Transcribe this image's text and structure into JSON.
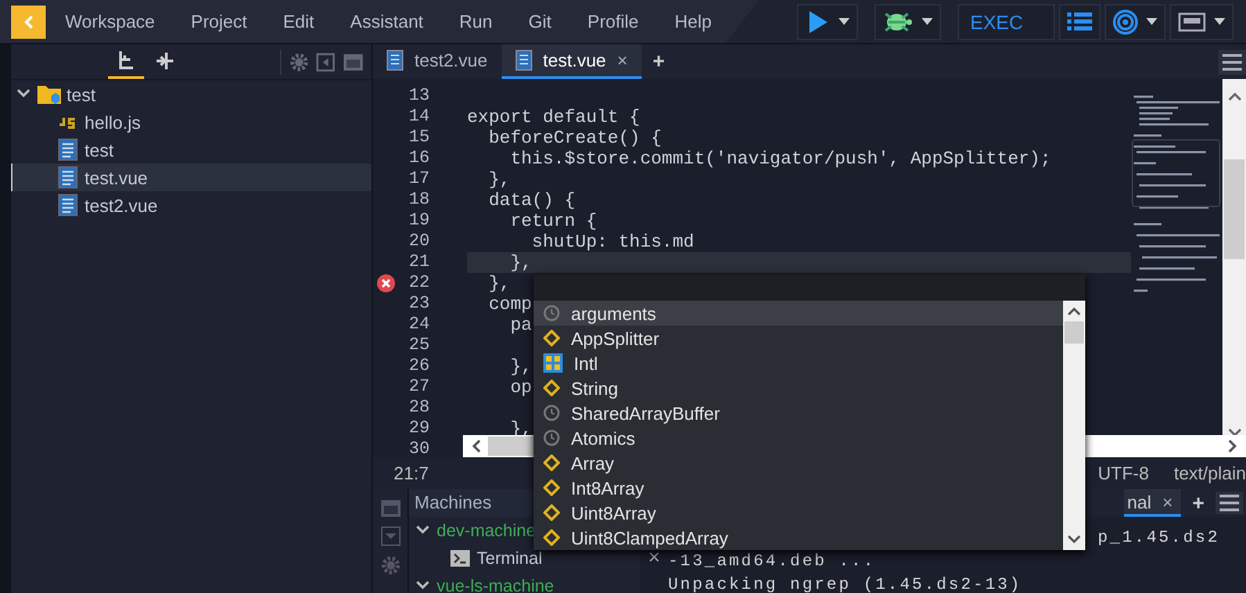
{
  "menu": {
    "items": [
      "Workspace",
      "Project",
      "Edit",
      "Assistant",
      "Run",
      "Git",
      "Profile",
      "Help"
    ]
  },
  "toolbar": [
    {
      "kind": "run",
      "caret": true
    },
    {
      "kind": "debug",
      "caret": true
    },
    {
      "kind": "exec",
      "label": "EXEC"
    },
    {
      "kind": "list",
      "caret": false
    },
    {
      "kind": "target",
      "caret": true
    },
    {
      "kind": "window",
      "caret": true
    }
  ],
  "sidebar": {
    "tabs": [
      {
        "kind": "tree",
        "selected": true
      },
      {
        "kind": "split",
        "selected": false
      }
    ],
    "tree": [
      {
        "name": "test",
        "kind": "folder",
        "expanded": true,
        "selected": false,
        "children": [
          {
            "name": "hello.js",
            "kind": "js",
            "selected": false
          },
          {
            "name": "test",
            "kind": "file",
            "selected": false
          },
          {
            "name": "test.vue",
            "kind": "file",
            "selected": true
          },
          {
            "name": "test2.vue",
            "kind": "file",
            "selected": false
          }
        ]
      }
    ]
  },
  "editor": {
    "tabs": [
      {
        "label": "test2.vue",
        "selected": false
      },
      {
        "label": "test.vue",
        "selected": true,
        "close": "×"
      }
    ],
    "add": "+",
    "lines": [
      {
        "number": "13",
        "current": false,
        "error": false
      },
      {
        "number": "14",
        "code": "export default {",
        "current": false,
        "error": false
      },
      {
        "number": "15",
        "code": "  beforeCreate() {",
        "current": false,
        "error": false
      },
      {
        "number": "16",
        "code": "    this.$store.commit('navigator/push', AppSplitter);",
        "current": false,
        "error": false
      },
      {
        "number": "17",
        "code": "  },",
        "current": false,
        "error": false
      },
      {
        "number": "18",
        "code": "  data() {",
        "current": false,
        "error": false
      },
      {
        "number": "19",
        "code": "    return {",
        "current": false,
        "error": false
      },
      {
        "number": "20",
        "code": "      shutUp: this.md",
        "current": false,
        "error": false
      },
      {
        "number": "21",
        "code": "    },",
        "current": true,
        "error": false
      },
      {
        "number": "22",
        "code": "  },",
        "current": false,
        "error": true
      },
      {
        "number": "23",
        "code": "  comp",
        "current": false,
        "error": false
      },
      {
        "number": "24",
        "code": "    pa",
        "current": false,
        "error": false
      },
      {
        "number": "25",
        "current": false,
        "error": false
      },
      {
        "number": "26",
        "code": "    },",
        "current": false,
        "error": false
      },
      {
        "number": "27",
        "code": "    op",
        "current": false,
        "error": false
      },
      {
        "number": "28",
        "current": false,
        "error": false
      },
      {
        "number": "29",
        "code": "    },",
        "current": false,
        "error": false
      },
      {
        "number": "30",
        "current": false,
        "error": false
      }
    ]
  },
  "autocomplete": [
    {
      "label": "arguments",
      "kind": "variable",
      "selected": true
    },
    {
      "label": "AppSplitter",
      "kind": "class",
      "selected": false
    },
    {
      "label": "Intl",
      "kind": "module",
      "selected": false
    },
    {
      "label": "String",
      "kind": "class",
      "selected": false
    },
    {
      "label": "SharedArrayBuffer",
      "kind": "variable",
      "selected": false
    },
    {
      "label": "Atomics",
      "kind": "variable",
      "selected": false
    },
    {
      "label": "Array",
      "kind": "class",
      "selected": false
    },
    {
      "label": "Int8Array",
      "kind": "class",
      "selected": false
    },
    {
      "label": "Uint8Array",
      "kind": "class",
      "selected": false
    },
    {
      "label": "Uint8ClampedArray",
      "kind": "class",
      "selected": false
    }
  ],
  "status_bar": {
    "position": "21:7",
    "encoding": "UTF-8",
    "type": "text/plain"
  },
  "machines": {
    "title": "Machines",
    "items": [
      {
        "name": "dev-machine",
        "expanded": true,
        "children": [
          {
            "name": "Terminal"
          }
        ]
      },
      {
        "name": "vue-ls-machine",
        "expanded": true
      }
    ]
  },
  "terminal": {
    "tab_label": "nal",
    "close": "×",
    "add": "+",
    "side_close": "×",
    "lines": [
      {
        "text": "p_1.45.ds2",
        "kind": "tail"
      },
      {
        "text": "-13_amd64.deb ...",
        "kind": "line"
      },
      {
        "text": "Unpacking ngrep (1.45.ds2-13)",
        "kind": "line"
      }
    ]
  }
}
